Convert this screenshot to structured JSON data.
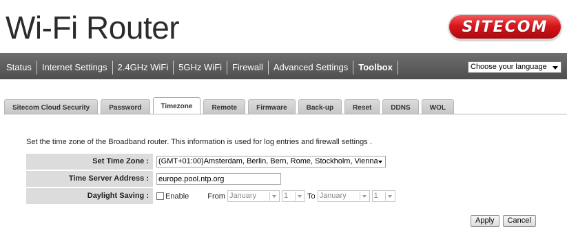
{
  "header": {
    "title": "Wi-Fi Router",
    "logo_text": "SITECOM"
  },
  "nav": {
    "items": [
      "Status",
      "Internet Settings",
      "2.4GHz WiFi",
      "5GHz WiFi",
      "Firewall",
      "Advanced Settings",
      "Toolbox"
    ],
    "active": "Toolbox",
    "language_select": "Choose your language"
  },
  "tabs": {
    "items": [
      "Sitecom Cloud Security",
      "Password",
      "Timezone",
      "Remote",
      "Firmware",
      "Back-up",
      "Reset",
      "DDNS",
      "WOL"
    ],
    "active": "Timezone"
  },
  "content": {
    "description": "Set the time zone of the Broadband router. This information is used for log entries and firewall settings .",
    "time_zone": {
      "label": "Set Time Zone :",
      "value": "(GMT+01:00)Amsterdam, Berlin, Bern, Rome, Stockholm, Vienna"
    },
    "time_server": {
      "label": "Time Server Address :",
      "value": "europe.pool.ntp.org"
    },
    "daylight": {
      "label": "Daylight Saving :",
      "enable_label": "Enable",
      "enabled": false,
      "from_label": "From",
      "from_month": "January",
      "from_day": "1",
      "to_label": "To",
      "to_month": "January",
      "to_day": "1"
    }
  },
  "buttons": {
    "apply": "Apply",
    "cancel": "Cancel"
  },
  "colors": {
    "nav_bg": "#5a5a5a",
    "logo_red": "#d9161c",
    "label_bg": "#dcdcdc"
  }
}
